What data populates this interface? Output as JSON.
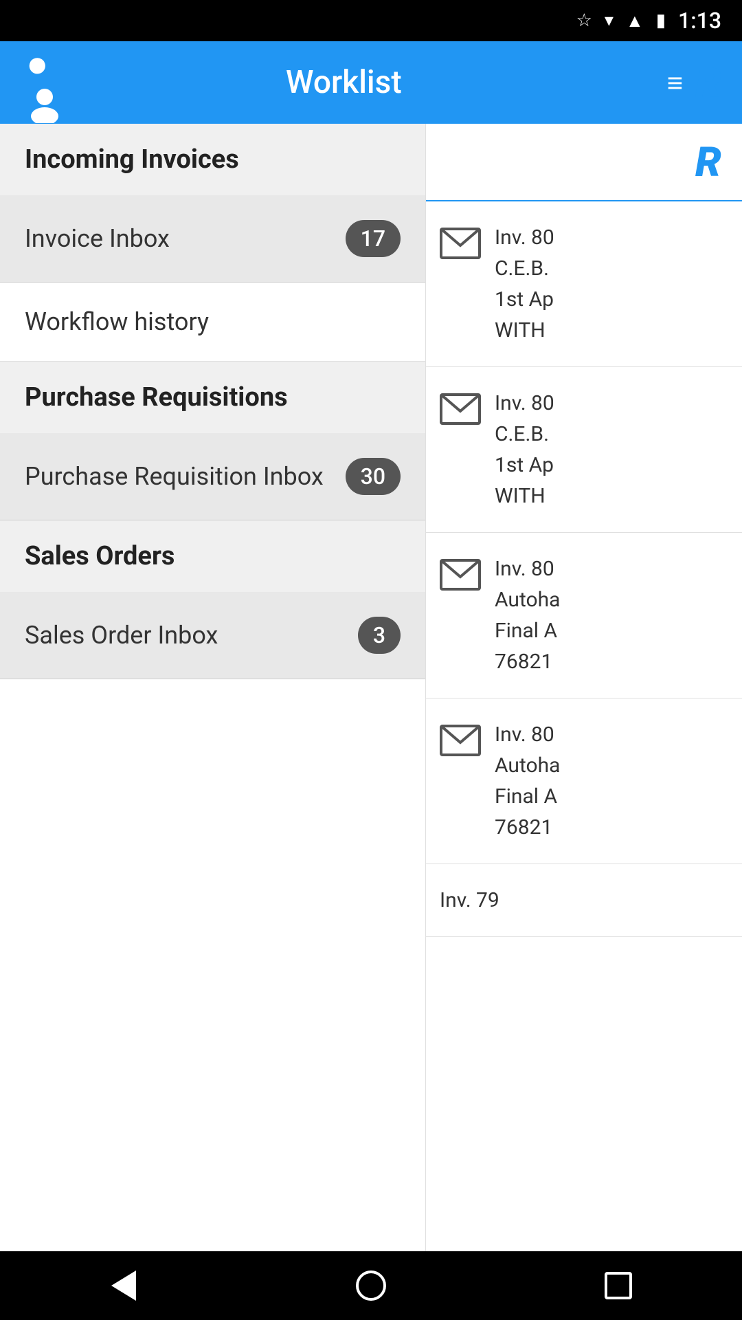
{
  "statusBar": {
    "time": "1:13",
    "icons": [
      "star",
      "wifi",
      "signal",
      "battery"
    ]
  },
  "header": {
    "title": "Worklist",
    "menuIcon": "≡",
    "logoLetter": "R"
  },
  "sidebar": {
    "sections": [
      {
        "id": "incoming-invoices",
        "label": "Incoming Invoices",
        "items": [
          {
            "id": "invoice-inbox",
            "label": "Invoice Inbox",
            "badge": "17"
          },
          {
            "id": "workflow-history",
            "label": "Workflow history",
            "badge": null
          }
        ]
      },
      {
        "id": "purchase-requisitions",
        "label": "Purchase Requisitions",
        "items": [
          {
            "id": "purchase-requisition-inbox",
            "label": "Purchase Requisition Inbox",
            "badge": "30"
          }
        ]
      },
      {
        "id": "sales-orders",
        "label": "Sales Orders",
        "items": [
          {
            "id": "sales-order-inbox",
            "label": "Sales Order Inbox",
            "badge": "3"
          }
        ]
      }
    ]
  },
  "rightPanel": {
    "emails": [
      {
        "id": "email-1",
        "lines": [
          "Inv. 80",
          "C.E.B.",
          "1st Ap",
          "WITH"
        ]
      },
      {
        "id": "email-2",
        "lines": [
          "Inv. 80",
          "C.E.B.",
          "1st Ap",
          "WITH"
        ]
      },
      {
        "id": "email-3",
        "lines": [
          "Inv. 80",
          "Autoha",
          "Final A",
          "76821"
        ]
      },
      {
        "id": "email-4",
        "lines": [
          "Inv. 80",
          "Autoha",
          "Final A",
          "76821"
        ]
      },
      {
        "id": "email-5",
        "lines": [
          "Inv. 79"
        ]
      }
    ]
  },
  "bottomNav": {
    "backLabel": "back",
    "homeLabel": "home",
    "recentsLabel": "recents"
  }
}
